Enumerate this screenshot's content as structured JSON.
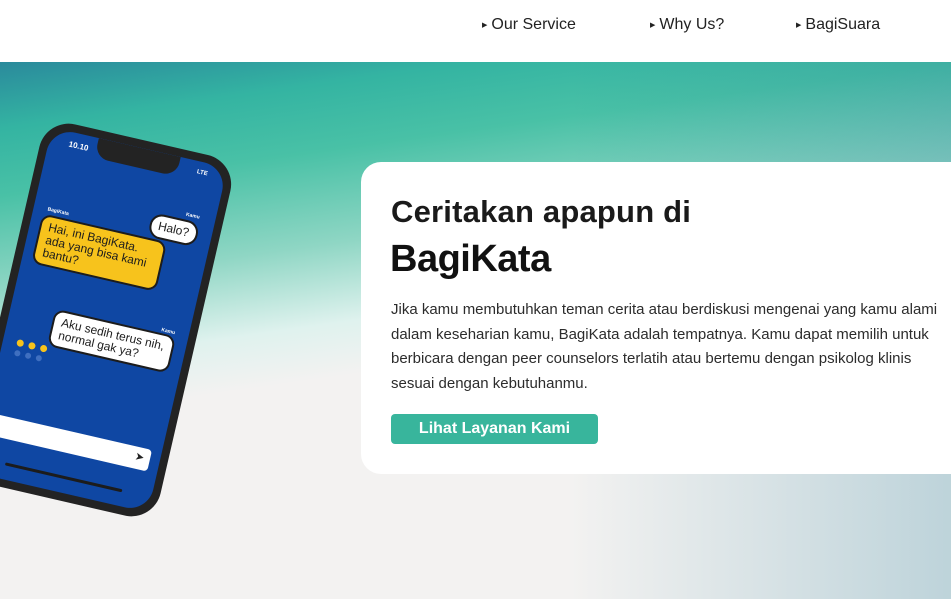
{
  "nav": {
    "items": [
      {
        "label": "Our Service"
      },
      {
        "label": "Why Us?"
      },
      {
        "label": "BagiSuara"
      }
    ]
  },
  "phone": {
    "time": "10.10",
    "network": "LTE",
    "messages": [
      {
        "sender": "Kamu",
        "text": "Halo?"
      },
      {
        "sender": "BagiKata",
        "text": "Hai, ini BagiKata. ada yang bisa kami bantu?"
      },
      {
        "sender": "Kamu",
        "text": "Aku sedih terus nih, normal gak ya?"
      }
    ]
  },
  "hero": {
    "heading": "Ceritakan apapun di",
    "brand": "BagiKata",
    "description": "Jika kamu membutuhkan teman cerita atau berdiskusi mengenai yang kamu alami dalam keseharian kamu, BagiKata adalah tempatnya. Kamu dapat memilih untuk berbicara dengan peer counselors terlatih atau bertemu dengan psikolog klinis sesuai dengan kebutuhanmu.",
    "cta_label": "Lihat Layanan Kami"
  },
  "colors": {
    "accent": "#38b59c",
    "phone_screen": "#0f47a3",
    "bubble_yellow": "#f7c31c"
  }
}
